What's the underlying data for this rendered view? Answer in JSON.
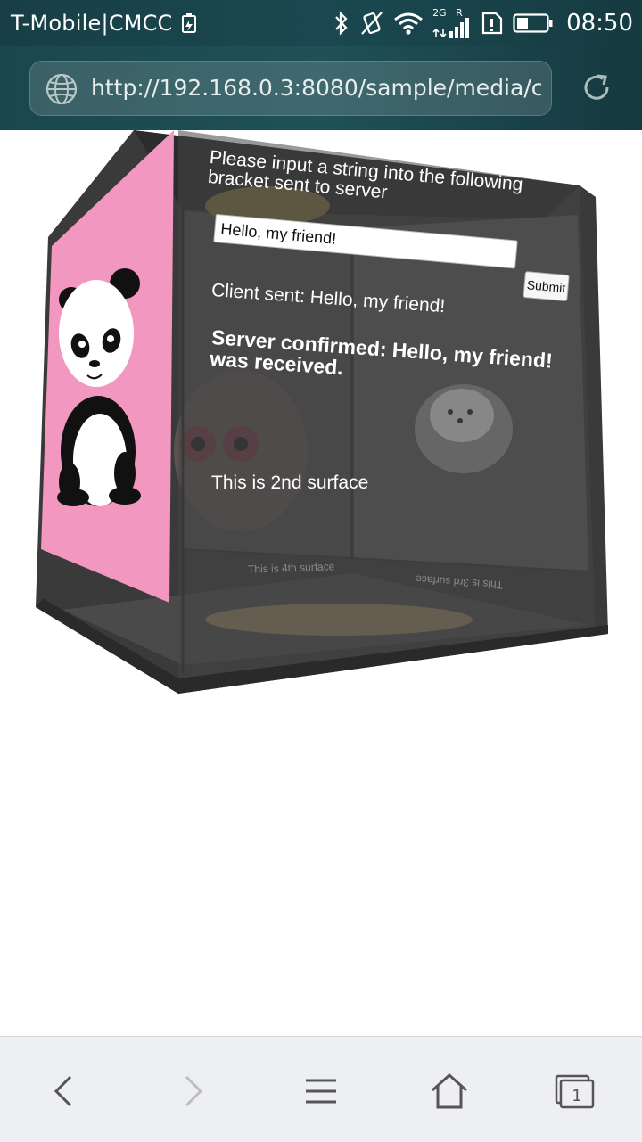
{
  "status_bar": {
    "carrier": "T-Mobile|CMCC",
    "network": "2G",
    "roaming": "R",
    "time": "08:50",
    "icons": [
      "battery-saver-icon",
      "bluetooth-icon",
      "vibrate-icon",
      "wifi-icon",
      "signal-icon",
      "sim-alert-icon",
      "battery-icon"
    ]
  },
  "browser": {
    "url": "http://192.168.0.3:8080/sample/media/c...",
    "tab_count": "1"
  },
  "cube": {
    "front": {
      "prompt": "Please input a string into the following bracket sent to server",
      "input_value": "Hello, my friend!",
      "submit_label": "Submit",
      "client_sent": "Client sent: Hello, my friend!",
      "server_confirmed": "Server confirmed: Hello, my friend! was received.",
      "surface_label": "This is 2nd surface"
    },
    "back_left_label": "This is 4th surface",
    "back_right_label": "This is 3rd surface",
    "colors": {
      "panda_bg": "#f197c0",
      "frame": "#3a3a3a"
    }
  },
  "nav": {
    "icons": [
      "back-icon",
      "forward-icon",
      "menu-icon",
      "home-icon",
      "tabs-icon"
    ]
  }
}
